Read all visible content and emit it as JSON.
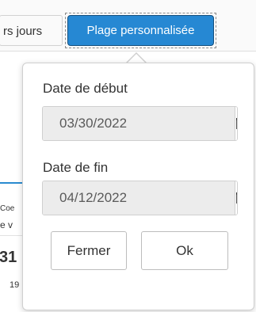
{
  "tabs": {
    "previous_label": "rs jours",
    "active_label": "Plage personnalisée"
  },
  "background": {
    "text1": "Coe",
    "text2": "e v",
    "text3": "31",
    "text4": "19"
  },
  "date_picker": {
    "start_label": "Date de début",
    "start_value": "03/30/2022",
    "end_label": "Date de fin",
    "end_value": "04/12/2022",
    "calendar_icon": "calendar-icon",
    "close_label": "Fermer",
    "ok_label": "Ok"
  },
  "colors": {
    "accent": "#2688d3"
  }
}
